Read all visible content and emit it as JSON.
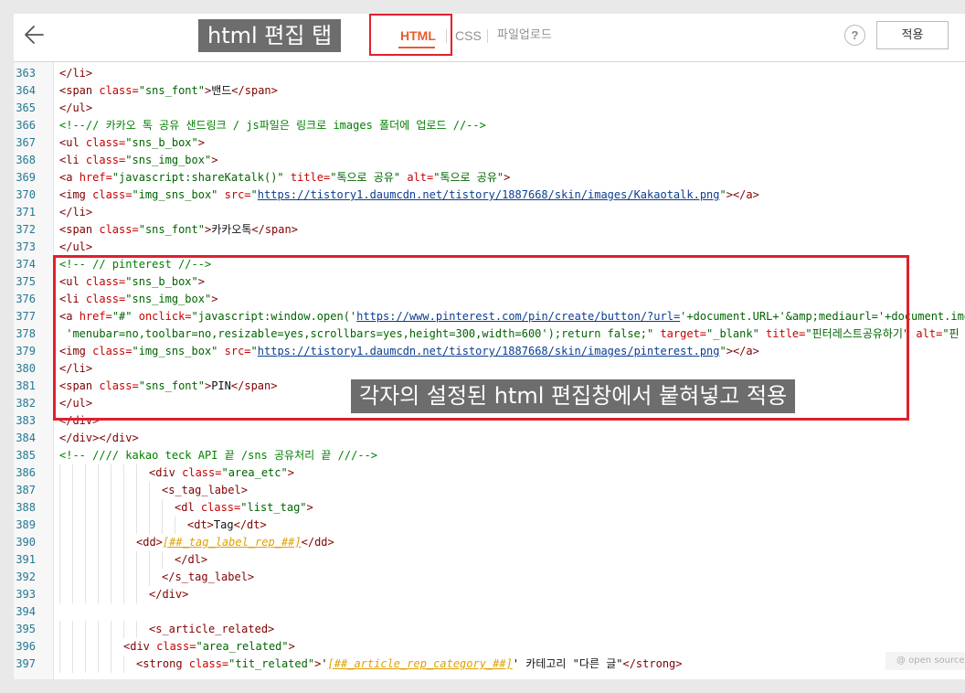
{
  "toolbar": {
    "back_icon": "arrow-left-icon",
    "annotation_top": "html 편집 탭",
    "tabs": [
      {
        "label": "HTML",
        "active": true
      },
      {
        "label": "CSS",
        "active": false
      },
      {
        "label": "파일업로드",
        "active": false
      }
    ],
    "help_label": "?",
    "apply_label": "적용",
    "accent_color": "#e85d2a",
    "highlight_color": "#e0202e"
  },
  "annotation_mid": "각자의 설정된 html 편집창에서 붙혀넣고 적용",
  "watermark": "@ open source",
  "editor": {
    "lines": [
      {
        "n": "363",
        "indent": 0,
        "tokens": [
          [
            "t",
            "</li>"
          ]
        ]
      },
      {
        "n": "364",
        "indent": 0,
        "tokens": [
          [
            "t",
            "<span "
          ],
          [
            "a",
            "class="
          ],
          [
            "s",
            "\"sns_font\""
          ],
          [
            "t",
            ">"
          ],
          [
            "x",
            "밴드"
          ],
          [
            "t",
            "</span>"
          ]
        ]
      },
      {
        "n": "365",
        "indent": 0,
        "tokens": [
          [
            "t",
            "</ul>"
          ]
        ]
      },
      {
        "n": "366",
        "indent": 0,
        "tokens": [
          [
            "c",
            "<!--// 카카오 톡 공유 샌드링크 / js파일은 링크로 images 폴더에 업로드 //-->"
          ]
        ]
      },
      {
        "n": "367",
        "indent": 0,
        "tokens": [
          [
            "t",
            "<ul "
          ],
          [
            "a",
            "class="
          ],
          [
            "s",
            "\"sns_b_box\""
          ],
          [
            "t",
            ">"
          ]
        ]
      },
      {
        "n": "368",
        "indent": 0,
        "tokens": [
          [
            "t",
            "<li "
          ],
          [
            "a",
            "class="
          ],
          [
            "s",
            "\"sns_img_box\""
          ],
          [
            "t",
            ">"
          ]
        ]
      },
      {
        "n": "369",
        "indent": 0,
        "tokens": [
          [
            "t",
            "<a "
          ],
          [
            "a",
            "href="
          ],
          [
            "s",
            "\"javascript:shareKatalk()\""
          ],
          [
            "a",
            " title="
          ],
          [
            "s",
            "\"톡으로 공유\""
          ],
          [
            "a",
            " alt="
          ],
          [
            "s",
            "\"톡으로 공유\""
          ],
          [
            "t",
            ">"
          ]
        ]
      },
      {
        "n": "370",
        "indent": 0,
        "tokens": [
          [
            "t",
            "<img "
          ],
          [
            "a",
            "class="
          ],
          [
            "s",
            "\"img_sns_box\""
          ],
          [
            "a",
            " src="
          ],
          [
            "s",
            "\""
          ],
          [
            "l",
            "https://tistory1.daumcdn.net/tistory/1887668/skin/images/Kakaotalk.png"
          ],
          [
            "s",
            "\""
          ],
          [
            "t",
            "></a>"
          ]
        ]
      },
      {
        "n": "371",
        "indent": 0,
        "tokens": [
          [
            "t",
            "</li>"
          ]
        ]
      },
      {
        "n": "372",
        "indent": 0,
        "tokens": [
          [
            "t",
            "<span "
          ],
          [
            "a",
            "class="
          ],
          [
            "s",
            "\"sns_font\""
          ],
          [
            "t",
            ">"
          ],
          [
            "x",
            "카카오톡"
          ],
          [
            "t",
            "</span>"
          ]
        ]
      },
      {
        "n": "373",
        "indent": 0,
        "tokens": [
          [
            "t",
            "</ul>"
          ]
        ]
      },
      {
        "n": "374",
        "indent": 0,
        "tokens": [
          [
            "c",
            "<!-- // pinterest //-->"
          ]
        ]
      },
      {
        "n": "375",
        "indent": 0,
        "tokens": [
          [
            "t",
            "<ul "
          ],
          [
            "a",
            "class="
          ],
          [
            "s",
            "\"sns_b_box\""
          ],
          [
            "t",
            ">"
          ]
        ]
      },
      {
        "n": "376",
        "indent": 0,
        "tokens": [
          [
            "t",
            "<li "
          ],
          [
            "a",
            "class="
          ],
          [
            "s",
            "\"sns_img_box\""
          ],
          [
            "t",
            ">"
          ]
        ]
      },
      {
        "n": "377",
        "indent": 0,
        "tokens": [
          [
            "t",
            "<a "
          ],
          [
            "a",
            "href="
          ],
          [
            "s",
            "\"#\""
          ],
          [
            "a",
            " onclick="
          ],
          [
            "s",
            "\"javascript:window.open('"
          ],
          [
            "l",
            "https://www.pinterest.com/pin/create/button/?url="
          ],
          [
            "s",
            "'+document.URL+'&amp;mediaurl='+document.img+"
          ]
        ]
      },
      {
        "n": "378",
        "indent": 0,
        "tokens": [
          [
            "s",
            " 'menubar=no,toolbar=no,resizable=yes,scrollbars=yes,height=300,width=600');return false;\""
          ],
          [
            "a",
            " target="
          ],
          [
            "s",
            "\"_blank\""
          ],
          [
            "a",
            " title="
          ],
          [
            "s",
            "\"핀터레스트공유하기\""
          ],
          [
            "a",
            " alt="
          ],
          [
            "s",
            "\"핀"
          ]
        ]
      },
      {
        "n": "379",
        "indent": 0,
        "tokens": [
          [
            "t",
            "<img "
          ],
          [
            "a",
            "class="
          ],
          [
            "s",
            "\"img_sns_box\""
          ],
          [
            "a",
            " src="
          ],
          [
            "s",
            "\""
          ],
          [
            "l",
            "https://tistory1.daumcdn.net/tistory/1887668/skin/images/pinterest.png"
          ],
          [
            "s",
            "\""
          ],
          [
            "t",
            "></a>"
          ]
        ]
      },
      {
        "n": "380",
        "indent": 0,
        "tokens": [
          [
            "t",
            "</li>"
          ]
        ]
      },
      {
        "n": "381",
        "indent": 0,
        "tokens": [
          [
            "t",
            "<span "
          ],
          [
            "a",
            "class="
          ],
          [
            "s",
            "\"sns_font\""
          ],
          [
            "t",
            ">"
          ],
          [
            "x",
            "PIN"
          ],
          [
            "t",
            "</span>"
          ]
        ]
      },
      {
        "n": "382",
        "indent": 0,
        "tokens": [
          [
            "t",
            "</ul>"
          ]
        ]
      },
      {
        "n": "383",
        "indent": 0,
        "tokens": [
          [
            "t",
            "</div>"
          ]
        ]
      },
      {
        "n": "384",
        "indent": 0,
        "tokens": [
          [
            "t",
            "</div></div>"
          ]
        ]
      },
      {
        "n": "385",
        "indent": 0,
        "tokens": [
          [
            "c",
            "<!-- //// kakao teck API 끝 /sns 공유처리 끝 ///-->"
          ]
        ]
      },
      {
        "n": "386",
        "indent": 7,
        "tokens": [
          [
            "t",
            "<div "
          ],
          [
            "a",
            "class="
          ],
          [
            "s",
            "\"area_etc\""
          ],
          [
            "t",
            ">"
          ]
        ]
      },
      {
        "n": "387",
        "indent": 8,
        "tokens": [
          [
            "t",
            "<s_tag_label>"
          ]
        ]
      },
      {
        "n": "388",
        "indent": 9,
        "tokens": [
          [
            "t",
            "<dl "
          ],
          [
            "a",
            "class="
          ],
          [
            "s",
            "\"list_tag\""
          ],
          [
            "t",
            ">"
          ]
        ]
      },
      {
        "n": "389",
        "indent": 10,
        "tokens": [
          [
            "t",
            "<dt>"
          ],
          [
            "x",
            "Tag"
          ],
          [
            "t",
            "</dt>"
          ]
        ]
      },
      {
        "n": "390",
        "indent": 6,
        "tokens": [
          [
            "t",
            "<dd>"
          ],
          [
            "v",
            "[##_tag_label_rep_##]"
          ],
          [
            "t",
            "</dd>"
          ]
        ]
      },
      {
        "n": "391",
        "indent": 9,
        "tokens": [
          [
            "t",
            "</dl>"
          ]
        ]
      },
      {
        "n": "392",
        "indent": 8,
        "tokens": [
          [
            "t",
            "</s_tag_label>"
          ]
        ]
      },
      {
        "n": "393",
        "indent": 7,
        "tokens": [
          [
            "t",
            "</div>"
          ]
        ]
      },
      {
        "n": "394",
        "indent": 0,
        "tokens": []
      },
      {
        "n": "395",
        "indent": 7,
        "tokens": [
          [
            "t",
            "<s_article_related>"
          ]
        ]
      },
      {
        "n": "396",
        "indent": 5,
        "tokens": [
          [
            "t",
            "<div "
          ],
          [
            "a",
            "class="
          ],
          [
            "s",
            "\"area_related\""
          ],
          [
            "t",
            ">"
          ]
        ]
      },
      {
        "n": "397",
        "indent": 6,
        "tokens": [
          [
            "t",
            "<strong "
          ],
          [
            "a",
            "class="
          ],
          [
            "s",
            "\"tit_related\""
          ],
          [
            "t",
            ">"
          ],
          [
            "x",
            "'"
          ],
          [
            "v",
            "[##_article_rep_category_##]"
          ],
          [
            "x",
            "' 카테고리 \"다른 글\""
          ],
          [
            "t",
            "</strong>"
          ]
        ]
      }
    ]
  }
}
